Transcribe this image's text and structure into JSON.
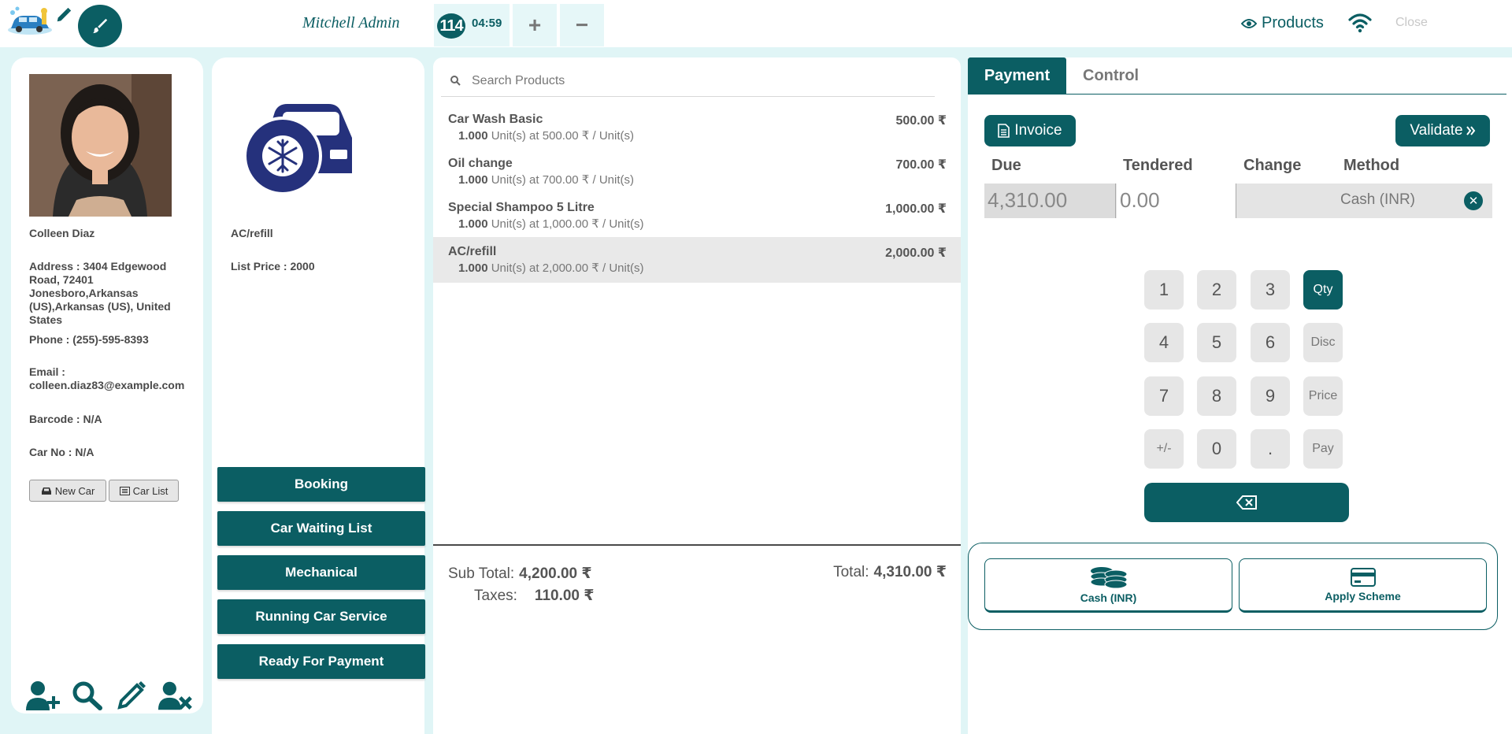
{
  "topbar": {
    "cashier": "Mitchell Admin",
    "order_number": "114",
    "order_time": "04:59",
    "add_label": "+",
    "remove_label": "−",
    "products_label": "Products",
    "close_label": "Close"
  },
  "customer": {
    "name": "Colleen Diaz",
    "address": "Address : 3404 Edgewood Road, 72401 Jonesboro,Arkansas (US),Arkansas (US), United States",
    "phone": "Phone : (255)-595-8393",
    "email": "Email : colleen.diaz83@example.com",
    "barcode": "Barcode : N/A",
    "car_no": "Car No : N/A",
    "new_car": "New Car",
    "car_list": "Car List"
  },
  "product": {
    "name": "AC/refill",
    "list_price": "List Price : 2000"
  },
  "actions": [
    {
      "label": "Booking"
    },
    {
      "label": "Car Waiting List"
    },
    {
      "label": "Mechanical"
    },
    {
      "label": "Running Car Service"
    },
    {
      "label": "Ready For Payment"
    }
  ],
  "search": {
    "placeholder": "Search Products"
  },
  "orderlines": [
    {
      "name": "Car Wash Basic",
      "price": "500.00 ₹",
      "qty": "1.000",
      "detail": "Unit(s) at 500.00 ₹ / Unit(s)",
      "selected": false
    },
    {
      "name": "Oil change",
      "price": "700.00 ₹",
      "qty": "1.000",
      "detail": "Unit(s) at 700.00 ₹ / Unit(s)",
      "selected": false
    },
    {
      "name": "Special Shampoo 5 Litre",
      "price": "1,000.00 ₹",
      "qty": "1.000",
      "detail": "Unit(s) at 1,000.00 ₹ / Unit(s)",
      "selected": false
    },
    {
      "name": "AC/refill",
      "price": "2,000.00 ₹",
      "qty": "1.000",
      "detail": "Unit(s) at 2,000.00 ₹ / Unit(s)",
      "selected": true
    }
  ],
  "totals": {
    "subtotal_label": "Sub Total:",
    "subtotal": "4,200.00 ₹",
    "taxes_label": "Taxes:",
    "taxes": "110.00 ₹",
    "total_label": "Total:",
    "total": "4,310.00 ₹"
  },
  "payment": {
    "tab_payment": "Payment",
    "tab_control": "Control",
    "invoice": "Invoice",
    "validate": "Validate",
    "headers": {
      "due": "Due",
      "tendered": "Tendered",
      "change": "Change",
      "method": "Method"
    },
    "due": "4,310.00",
    "tendered": "0.00",
    "change": "",
    "method": "Cash (INR)",
    "keypad": [
      "1",
      "2",
      "3",
      "Qty",
      "4",
      "5",
      "6",
      "Disc",
      "7",
      "8",
      "9",
      "Price",
      "+/-",
      "0",
      ".",
      "Pay"
    ],
    "active_mode": "Qty",
    "methods": [
      {
        "label": "Cash (INR)",
        "icon": "coins-icon"
      },
      {
        "label": "Apply Scheme",
        "icon": "credit-card-icon"
      }
    ]
  },
  "colors": {
    "primary": "#0b5e63",
    "background": "#e0f5f6"
  }
}
